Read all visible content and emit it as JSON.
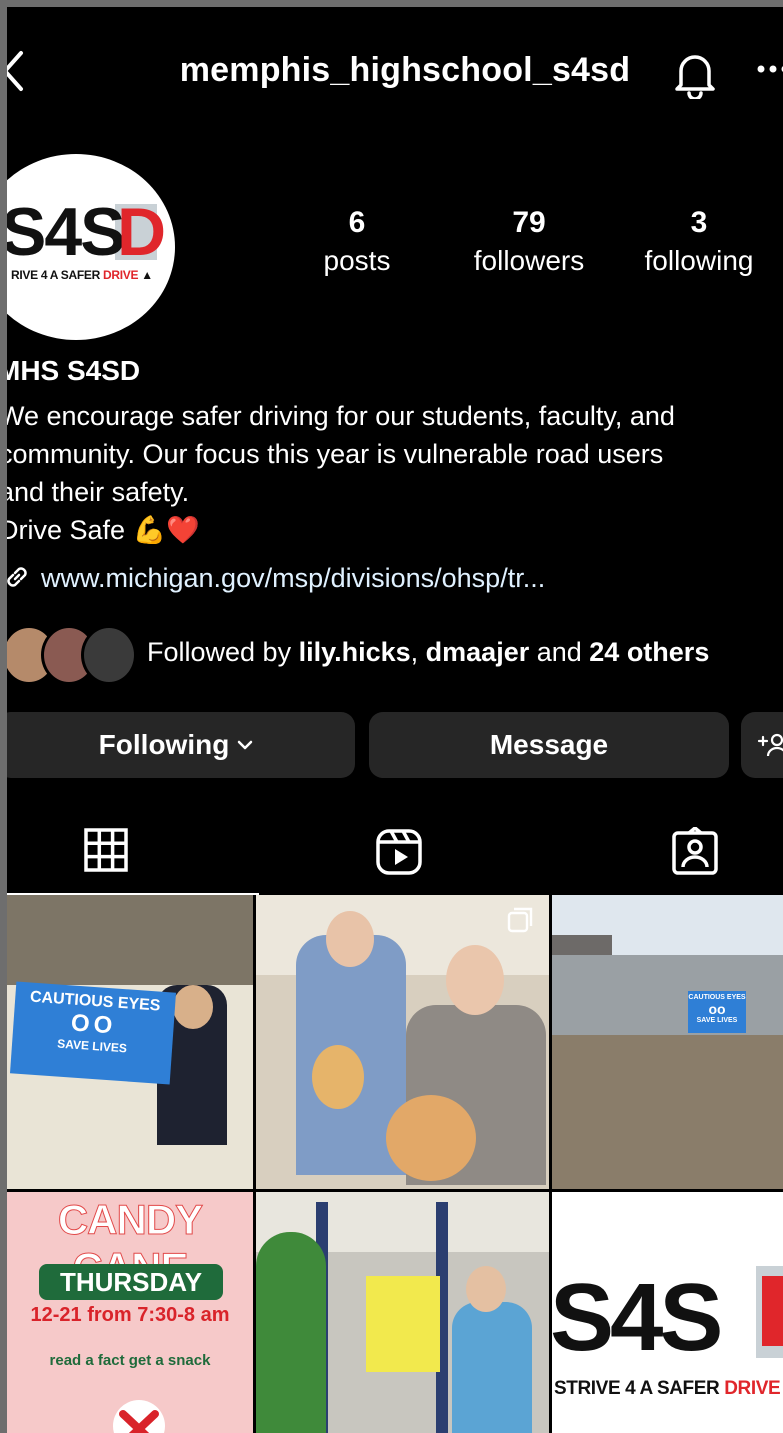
{
  "header": {
    "username": "memphis_highschool_s4sd"
  },
  "profile": {
    "avatar_logo": {
      "mark": "S4S",
      "mark_accent": "D",
      "tagline_left": "RIVE 4 A SAFER",
      "tagline_right": "DRIVE"
    },
    "stats": [
      {
        "value": "6",
        "label": "posts"
      },
      {
        "value": "79",
        "label": "followers"
      },
      {
        "value": "3",
        "label": "following"
      }
    ],
    "display_name": "MHS S4SD",
    "bio_lines": [
      "We encourage safer driving for our students, faculty, and",
      "community. Our focus this year is vulnerable road users",
      "and their safety.",
      "Drive Safe 💪❤️"
    ],
    "link": "www.michigan.gov/msp/divisions/ohsp/tr...",
    "followed_by": {
      "prefix": "Followed by ",
      "user1": "lily.hicks",
      "sep": ", ",
      "user2": "dmaajer",
      "and": " and ",
      "others": "24 others"
    }
  },
  "actions": {
    "following_label": "Following",
    "message_label": "Message",
    "add_label": "+"
  },
  "posts": {
    "post1": {
      "sign_title": "CAUTIOUS EYES",
      "sign_eyes": "OO",
      "sign_sub": "SAVE LIVES"
    },
    "post3": {
      "sign_title": "CAUTIOUS EYES",
      "sign_sub": "SAVE LIVES"
    },
    "post4": {
      "title": "CANDY CANE",
      "day": "THURSDAY",
      "time": "12-21 from 7:30-8 am",
      "fact": "read a fact get a snack"
    },
    "post6": {
      "mark": "S4S",
      "tagline_left": "STRIVE 4 A SAFER",
      "tagline_right": "DRIVE"
    }
  },
  "colors": {
    "background": "#000000",
    "button": "#262626",
    "brand_red": "#e0262b",
    "sign_blue": "#2f7fd6",
    "candy_green": "#1f6b3b"
  },
  "icons": [
    "back-chevron-icon",
    "bell-icon",
    "more-icon",
    "link-icon",
    "chevron-down-icon",
    "add-person-icon",
    "grid-icon",
    "reels-icon",
    "tagged-icon",
    "multiple-posts-icon"
  ]
}
